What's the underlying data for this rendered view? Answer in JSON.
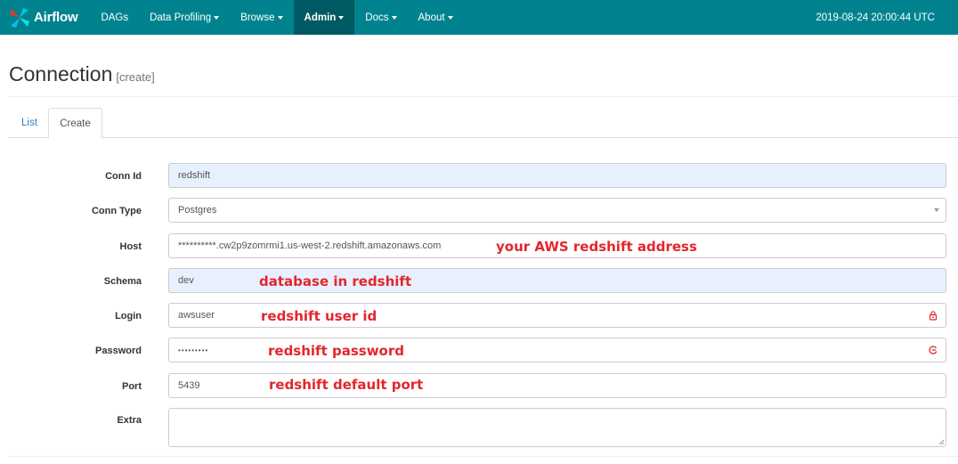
{
  "navbar": {
    "brand": "Airflow",
    "items": [
      {
        "label": "DAGs",
        "dropdown": false,
        "active": false
      },
      {
        "label": "Data Profiling",
        "dropdown": true,
        "active": false
      },
      {
        "label": "Browse",
        "dropdown": true,
        "active": false
      },
      {
        "label": "Admin",
        "dropdown": true,
        "active": true
      },
      {
        "label": "Docs",
        "dropdown": true,
        "active": false
      },
      {
        "label": "About",
        "dropdown": true,
        "active": false
      }
    ],
    "clock": "2019-08-24 20:00:44 UTC"
  },
  "header": {
    "title": "Connection",
    "subtitle": "[create]"
  },
  "tabs": {
    "list": "List",
    "create": "Create"
  },
  "form": {
    "conn_id": {
      "label": "Conn Id",
      "value": "redshift"
    },
    "conn_type": {
      "label": "Conn Type",
      "value": "Postgres"
    },
    "host": {
      "label": "Host",
      "value": "**********.cw2p9zomrmi1.us-west-2.redshift.amazonaws.com"
    },
    "schema": {
      "label": "Schema",
      "value": "dev"
    },
    "login": {
      "label": "Login",
      "value": "awsuser"
    },
    "password": {
      "label": "Password",
      "value": "•••••••••"
    },
    "port": {
      "label": "Port",
      "value": "5439"
    },
    "extra": {
      "label": "Extra",
      "value": ""
    }
  },
  "annotations": {
    "host": "your AWS redshift address",
    "schema": "database in redshift",
    "login": "redshift user id",
    "password": "redshift password",
    "port": "redshift default port"
  },
  "colors": {
    "navbar": "#00838f",
    "navbar_active": "#005a63",
    "annotation": "#e3262c",
    "autofill": "#e8f0fe"
  }
}
